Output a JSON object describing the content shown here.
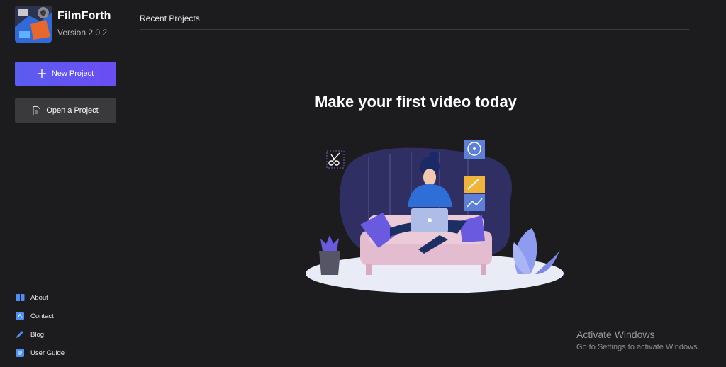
{
  "app": {
    "name": "FilmForth",
    "version": "Version  2.0.2"
  },
  "sidebar": {
    "new_project_label": "New Project",
    "open_project_label": "Open a Project",
    "links": [
      {
        "label": "About",
        "icon": "book-icon"
      },
      {
        "label": "Contact",
        "icon": "contact-icon"
      },
      {
        "label": "Blog",
        "icon": "pen-icon"
      },
      {
        "label": "User Guide",
        "icon": "guide-icon"
      }
    ]
  },
  "main": {
    "header_title": "Recent Projects",
    "hero_title": "Make your first video today"
  },
  "watermark": {
    "title": "Activate Windows",
    "subtitle": "Go to Settings to activate Windows."
  },
  "colors": {
    "background": "#1c1c1e",
    "accent": "#5b5cf0",
    "secondary_button": "#3a3a3d"
  }
}
